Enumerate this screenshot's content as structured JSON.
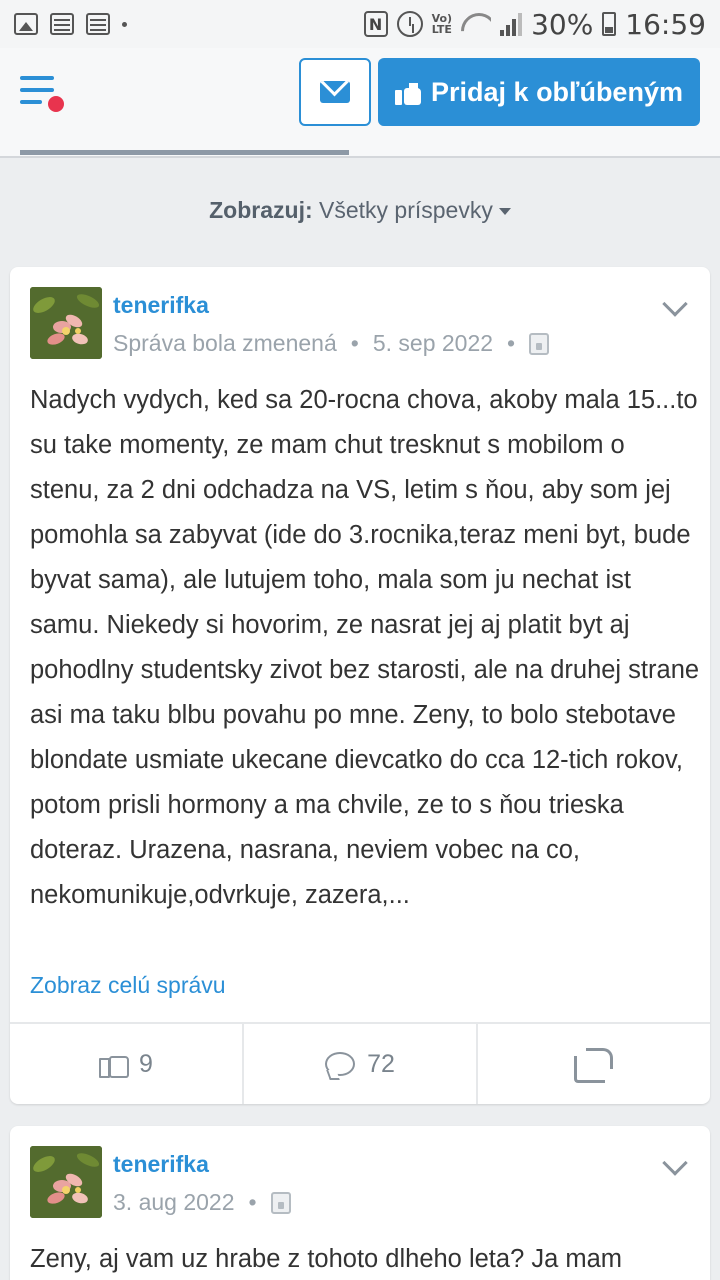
{
  "statusbar": {
    "battery": "30%",
    "time": "16:59",
    "icons": [
      "picture-icon",
      "calendar-icon",
      "calendar-icon",
      "dot-icon",
      "nfc-icon",
      "alarm-icon",
      "volte-icon",
      "wifi-icon",
      "signal-icon",
      "battery-icon"
    ]
  },
  "header": {
    "menu_icon": "hamburger-menu-icon",
    "mail_icon": "envelope-icon",
    "favorite_label": "Pridaj k obľúbeným",
    "favorite_icon": "thumbs-up-icon",
    "progress": 0.47
  },
  "filter": {
    "label": "Zobrazuj:",
    "value": "Všetky príspevky"
  },
  "posts": [
    {
      "author": "tenerifka",
      "edited_note": "Správa bola zmenená",
      "date": "5. sep 2022",
      "body": "Nadych vydych, ked sa 20-rocna chova, akoby mala 15...to su take momenty, ze mam chut tresknut s mobilom o stenu, za 2 dni odchadza na VS, letim s ňou, aby som jej pomohla sa zabyvat (ide do 3.rocnika,teraz meni byt, bude byvat sama), ale lutujem toho, mala som ju nechat ist samu. Niekedy si hovorim, ze nasrat jej aj platit byt aj pohodlny studentsky zivot bez starosti, ale na druhej strane asi ma taku blbu povahu po mne. Zeny, to bolo stebotave blondate usmiate ukecane dievcatko do cca 12-tich rokov, potom prisli hormony a ma chvile, ze to s ňou trieska doteraz. Urazena, nasrana, neviem vobec na co, nekomunikuje,odvrkuje, zazera,...",
      "more_label": "Zobraz celú správu",
      "likes": "9",
      "comments": "72"
    },
    {
      "author": "tenerifka",
      "date": "3. aug 2022",
      "body": "Zeny, aj vam uz hrabe z tohoto dlheho leta? Ja mam"
    }
  ],
  "colors": {
    "accent": "#2b8fd6",
    "notification": "#e8344e",
    "background": "#eceef0"
  }
}
